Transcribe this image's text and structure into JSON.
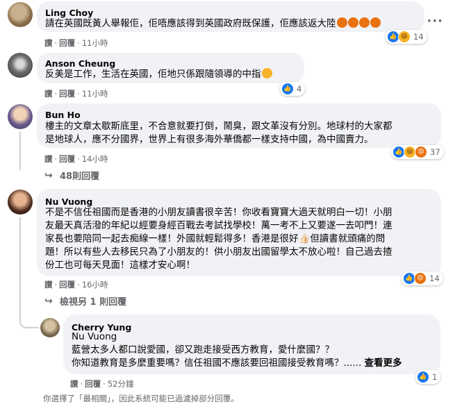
{
  "comments": [
    {
      "author": "Ling Choy",
      "lines": [
        "請在英國既黃人舉報佢，佢唔應該得到英國政府既保護，佢應該返大陸"
      ],
      "actions": {
        "like": "讚",
        "reply": "回覆",
        "time": "11小時"
      },
      "reactions": {
        "icons": [
          "like-icon",
          "haha-icon"
        ],
        "count": "14"
      }
    },
    {
      "author": "Anson Cheung",
      "lines": [
        "反美是工作，生活在英國，佢地只係跟隨領導的中指"
      ],
      "actions": {
        "like": "讚",
        "reply": "回覆",
        "time": "11小時"
      },
      "reactions": {
        "icons": [
          "like-icon"
        ],
        "count": "4"
      }
    },
    {
      "author": "Bun Ho",
      "lines": [
        "樓主的文章太歇斯底里，不合意就要打倒，鬧臭，跟文革沒有分別。地球村的大家都",
        "是地球人，應不分國界，世界上有很多海外華僑都一樣支持中國，為中國賣力。"
      ],
      "actions": {
        "like": "讚",
        "reply": "回覆",
        "time": "14小時"
      },
      "reactions": {
        "icons": [
          "like-icon",
          "haha-icon",
          "angry-icon"
        ],
        "count": "37"
      },
      "replies_link": "48則回覆"
    },
    {
      "author": "Nu Vuong",
      "lines": [
        "不是不信任祖國而是香港的小朋友讀書很辛苦！你收看寶寶大過天就明白一切！小朋",
        "友最天真活潑的年紀以經要身經百戰去考試找學校！萬一考不上又要遂一去叩門！連",
        "家長也要陪同一起去痴線一樣！外國就輕鬆得多！香港是很好👍🏻但讀書就頭痛的問",
        "題！所以有些人去移民只為了小朋友的！供小朋友出國留學太不放心啦！自己過去揸",
        "份工也可每天見面！這樣才安心啊！"
      ],
      "actions": {
        "like": "讚",
        "reply": "回覆",
        "time": "16小時"
      },
      "reactions": {
        "icons": [
          "like-icon",
          "angry-icon"
        ],
        "count": "14"
      },
      "replies_link": "檢視另 1 則回覆"
    }
  ],
  "reply": {
    "author": "Cherry Yung",
    "mention": "Nu Vuong",
    "lines": [
      "藍營太多人都口說愛國，卻又跑走接受西方教育，愛什麼國？？",
      "你知道教育是多麼重要嗎？信任祖國不應該要回祖國接受教育嗎？......"
    ],
    "see_more": "查看更多",
    "actions": {
      "like": "讚",
      "reply": "回覆",
      "time": "52分鐘"
    },
    "reactions": {
      "icons": [
        "like-icon"
      ],
      "count": "1"
    }
  },
  "footnote": "你選擇了「最相關」，因此系統可能已過濾掉部分回覆。",
  "more_options_icon": "more-horizontal-icon",
  "colors": {
    "bubble": "#f0f2f5",
    "like": "#1877f2",
    "meta": "#65676b",
    "angry": "#e9710f",
    "haha": "#f7b125"
  }
}
